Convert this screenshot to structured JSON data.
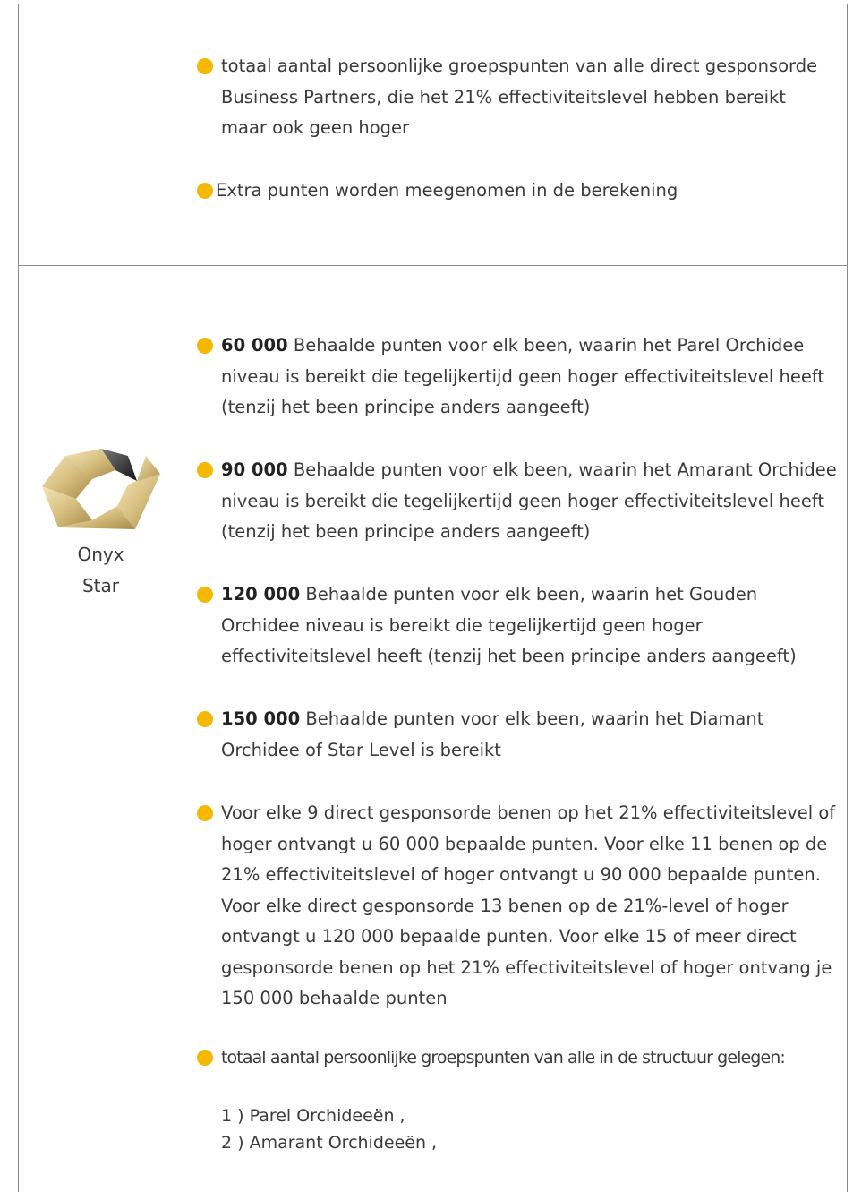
{
  "row1": {
    "bullets": [
      {
        "bold": "",
        "text": "totaal aantal persoonlijke groepspunten van alle direct gesponsorde Business Partners, die het 21%  effectiviteitslevel hebben bereikt maar ook geen hoger"
      },
      {
        "bold": "",
        "text": "Extra punten worden meegenomen in de berekening"
      }
    ]
  },
  "row2": {
    "rank": {
      "line1": "Onyx",
      "line2": "Star",
      "logo_icon": "onyx-star-logo-icon"
    },
    "bullets": [
      {
        "bold": "60 000",
        "text": " Behaalde punten voor elk been, waarin het  Parel Orchidee niveau is bereikt die tegelijkertijd geen hoger effectiviteitslevel heeft (tenzij het been principe anders aangeeft)"
      },
      {
        "bold": "90 000",
        "text": " Behaalde punten voor elk been, waarin het  Amarant Orchidee niveau is bereikt die tegelijkertijd geen hoger effectiviteitslevel heeft (tenzij het been principe anders aangeeft)"
      },
      {
        "bold": "120 000",
        "text": " Behaalde punten voor elk been, waarin het Gouden Orchidee niveau is bereikt die tegelijkertijd geen hoger effectiviteitslevel heeft (tenzij het been principe anders aangeeft)"
      },
      {
        "bold": "150 000",
        "text": " Behaalde punten voor elk been, waarin het Diamant Orchidee of Star Level is bereikt"
      },
      {
        "bold": "",
        "text": "Voor elke 9 direct gesponsorde benen op het 21% effectiviteitslevel of hoger ontvangt u 60 000 bepaalde punten. Voor elke 11 benen op de 21% effectiviteitslevel of hoger ontvangt u 90 000 bepaalde punten. Voor elke direct gesponsorde 13 benen op de 21%-level of hoger ontvangt u 120 000 bepaalde punten. Voor elke 15 of meer direct gesponsorde benen op het 21% effectiviteitslevel of hoger ontvang je 150 000 behaalde punten"
      },
      {
        "bold": "",
        "text": "totaal aantal persoonlijke groepspunten van alle  in de structuur gelegen:"
      }
    ],
    "list": [
      "1 ) Parel Orchideeën ,",
      "2 ) Amarant Orchideeën ,"
    ]
  },
  "colors": {
    "bullet": "#f5b800",
    "border": "#8a8a8a",
    "text": "#3a3a3a"
  }
}
